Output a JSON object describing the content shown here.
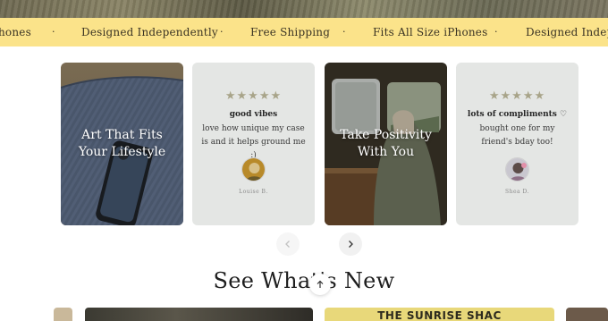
{
  "marquee": {
    "items": [
      "hones",
      "Designed Independently",
      "Free Shipping",
      "Fits All Size iPhones",
      "Designed Independ"
    ],
    "separator": "·"
  },
  "cards": [
    {
      "kind": "image",
      "title": "Art That Fits Your Lifestyle"
    },
    {
      "kind": "review",
      "stars": "★★★★★",
      "title": "good vibes",
      "text": "love how unique my case is and it helps ground me :)",
      "reviewer": "Louise B."
    },
    {
      "kind": "image",
      "title": "Take Positivity With You"
    },
    {
      "kind": "review",
      "stars": "★★★★★",
      "title": "lots of compliments ♡",
      "text": "bought one for my friend's bday too!",
      "reviewer": "Shea D."
    }
  ],
  "carousel": {
    "prev_icon": "chevron-left-icon",
    "next_icon": "chevron-right-icon"
  },
  "section": {
    "title": "See What's New"
  },
  "scroll_top_icon": "arrow-up-icon",
  "thumbs": {
    "sign_text": "THE SUNRISE SHAC"
  },
  "colors": {
    "marquee_bg": "#fbe38a",
    "review_card_bg": "#e4e6e4",
    "star_color": "#a8a489"
  }
}
